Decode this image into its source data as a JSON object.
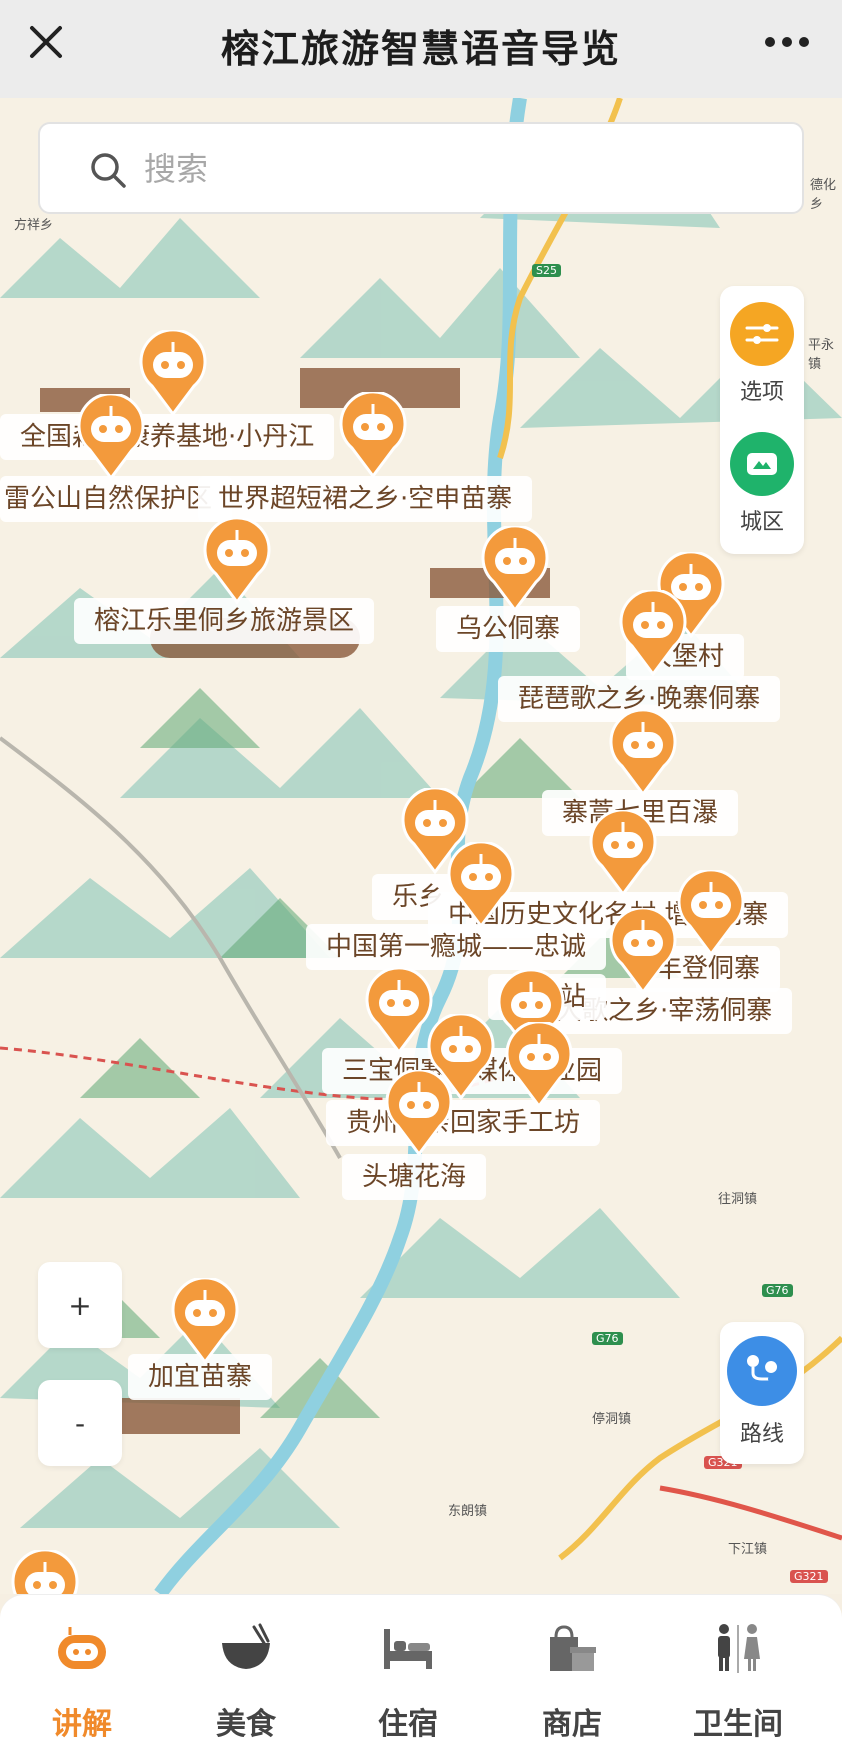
{
  "app": {
    "title": "榕江旅游智慧语音导览"
  },
  "search": {
    "placeholder": "搜索"
  },
  "panel": {
    "options_label": "选项",
    "city_label": "城区",
    "route_label": "路线"
  },
  "zoom": {
    "in_label": "+",
    "out_label": "-"
  },
  "map": {
    "place_names": [
      "方祥乡",
      "德化乡",
      "平永镇",
      "往洞镇",
      "停洞镇",
      "东朗镇",
      "下江镇"
    ],
    "road_labels": [
      "S25",
      "G76",
      "G76",
      "G321",
      "G321"
    ],
    "spots": [
      "全国森林康养基地·小丹江",
      "雷公山自然保护区",
      "世界超短裙之乡·空申苗寨",
      "榕江乐里侗乡旅游景区",
      "乌公侗寨",
      "大堡村",
      "琵琶歌之乡·晚寨侗寨",
      "寨蒿七里百瀑",
      "乐乡",
      "中国历史文化名村·增冲侗寨",
      "中国第一瘾城——忠诚",
      "丰登侗寨",
      "大歌之乡·宰荡侗寨",
      "车江站",
      "三宝侗寨新媒体产业园",
      "贵州母亲回家手工坊",
      "头塘花海",
      "加宜苗寨"
    ]
  },
  "colors": {
    "accent": "#f08a2b",
    "marker": "#f39a3c",
    "city_green": "#1fb36b",
    "route_blue": "#3d8ee6",
    "label_text": "#6b4527"
  },
  "nav": {
    "items": [
      {
        "label": "讲解",
        "icon": "robot-icon",
        "active": true
      },
      {
        "label": "美食",
        "icon": "bowl-icon",
        "active": false
      },
      {
        "label": "住宿",
        "icon": "bed-icon",
        "active": false
      },
      {
        "label": "商店",
        "icon": "shop-icon",
        "active": false
      },
      {
        "label": "卫生间",
        "icon": "restroom-icon",
        "active": false
      }
    ]
  }
}
